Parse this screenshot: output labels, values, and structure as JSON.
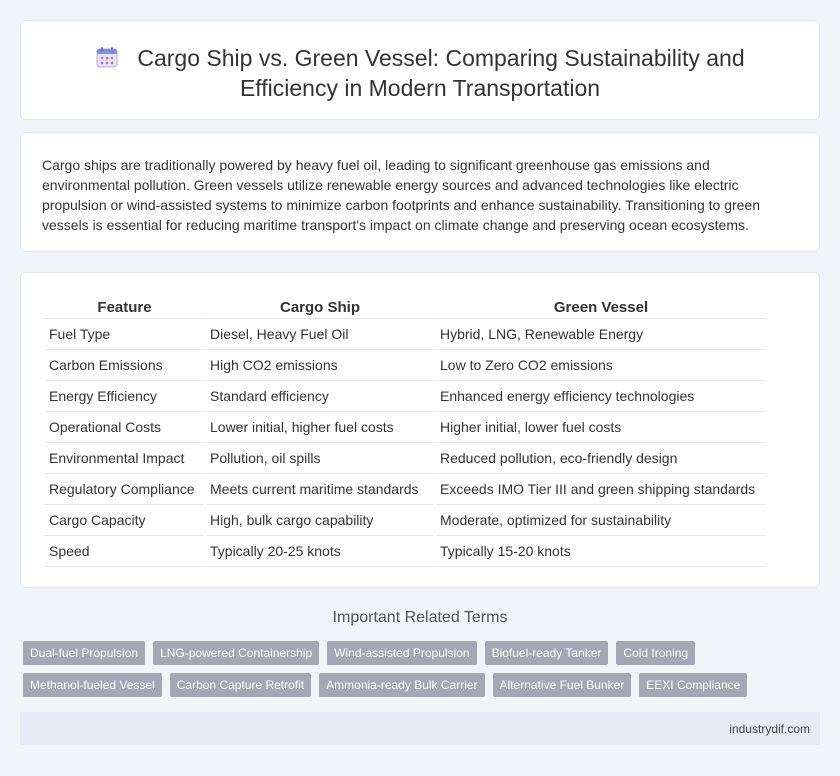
{
  "header": {
    "title_line1": "Cargo Ship vs. Green Vessel: Comparing Sustainability and",
    "title_line2": "Efficiency in Modern Transportation",
    "icon": "calendar-icon"
  },
  "intro": {
    "text": "Cargo ships are traditionally powered by heavy fuel oil, leading to significant greenhouse gas emissions and environmental pollution. Green vessels utilize renewable energy sources and advanced technologies like electric propulsion or wind-assisted systems to minimize carbon footprints and enhance sustainability. Transitioning to green vessels is essential for reducing maritime transport's impact on climate change and preserving ocean ecosystems."
  },
  "table": {
    "headers": [
      "Feature",
      "Cargo Ship",
      "Green Vessel"
    ],
    "rows": [
      [
        "Fuel Type",
        "Diesel, Heavy Fuel Oil",
        "Hybrid, LNG, Renewable Energy"
      ],
      [
        "Carbon Emissions",
        "High CO2 emissions",
        "Low to Zero CO2 emissions"
      ],
      [
        "Energy Efficiency",
        "Standard efficiency",
        "Enhanced energy efficiency technologies"
      ],
      [
        "Operational Costs",
        "Lower initial, higher fuel costs",
        "Higher initial, lower fuel costs"
      ],
      [
        "Environmental Impact",
        "Pollution, oil spills",
        "Reduced pollution, eco-friendly design"
      ],
      [
        "Regulatory Compliance",
        "Meets current maritime standards",
        "Exceeds IMO Tier III and green shipping standards"
      ],
      [
        "Cargo Capacity",
        "High, bulk cargo capability",
        "Moderate, optimized for sustainability"
      ],
      [
        "Speed",
        "Typically 20-25 knots",
        "Typically 15-20 knots"
      ]
    ]
  },
  "related": {
    "title": "Important Related Terms",
    "row1": [
      "Dual-fuel Propulsion",
      "LNG-powered Containership",
      "Wind-assisted Propulsion",
      "Biofuel-ready Tanker",
      "Cold Ironing"
    ],
    "row2": [
      "Methanol-fueled Vessel",
      "Carbon Capture Retrofit",
      "Ammonia-ready Bulk Carrier",
      "Alternative Fuel Bunker",
      "EEXI Compliance"
    ]
  },
  "footer": {
    "site": "industrydif.com"
  }
}
